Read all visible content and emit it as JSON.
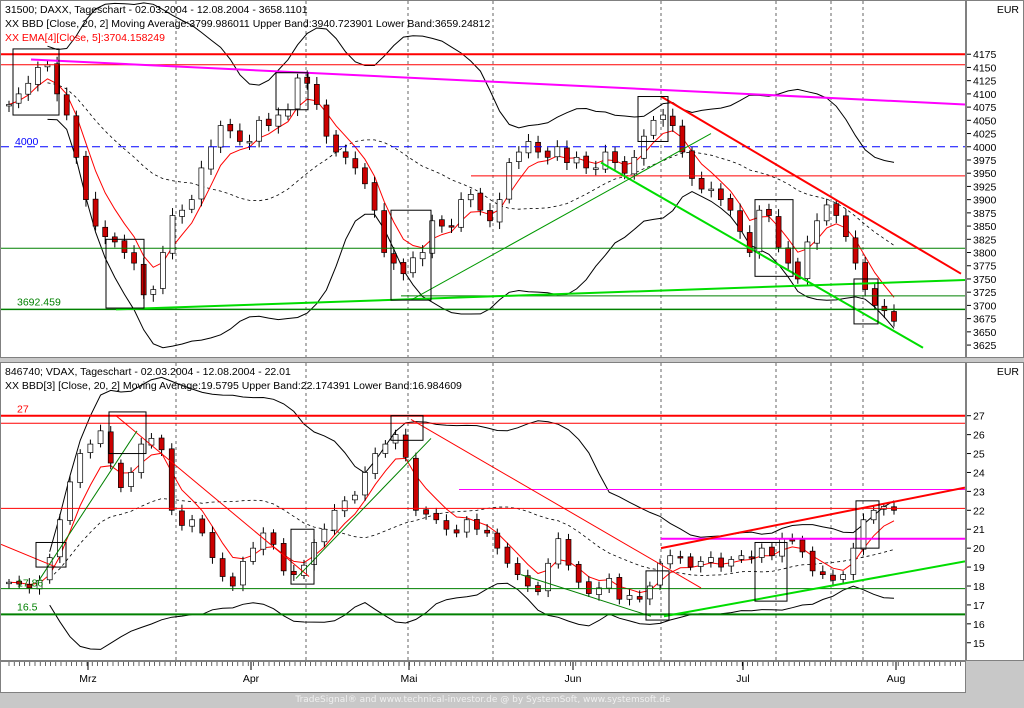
{
  "upper_panel": {
    "header_line1": "31500; DAXX, Tageschart - 02.03.2004 - 12.08.2004 - 3658.1101",
    "header_line2": "XX BBD [Close, 20, 2] Moving Average:3799.986011 Upper Band:3940.723901 Lower Band:3659.24812",
    "header_line3": "XX EMA[4][Close, 5]:3704.158249",
    "currency": "EUR",
    "level_labels": [
      "4000",
      "3692.459"
    ]
  },
  "lower_panel": {
    "header_line1": "846740; VDAX, Tageschart - 02.03.2004 - 12.08.2004 - 22.01",
    "header_line2": "XX BBD[3] [Close, 20, 2] Moving Average:19.5795 Upper Band:22.174391 Lower Band:16.984609",
    "currency": "EUR",
    "level_labels": [
      "27",
      "17.86",
      "16.5"
    ]
  },
  "footer": "TradeSignal® and www.technical-investor.de @ by SystemSoft, www.systemsoft.de",
  "colors": {
    "up": "#ffffff",
    "down": "#cc0000",
    "red": "#ff0000",
    "magenta": "#ff00ff",
    "green": "#00dd00",
    "darkgreen": "#008000",
    "blue": "#0000ff"
  },
  "chart_data": [
    {
      "type": "candlestick",
      "title": "31500; DAXX, Tageschart - 02.03.2004 - 12.08.2004 - 3658.1101",
      "ylim": [
        3610,
        4200
      ],
      "yticks": [
        3625,
        3650,
        3675,
        3700,
        3725,
        3750,
        3775,
        3800,
        3825,
        3850,
        3875,
        3900,
        3925,
        3950,
        3975,
        4000,
        4025,
        4050,
        4075,
        4100,
        4125,
        4150,
        4175
      ],
      "x_months": [
        "Mrz",
        "Apr",
        "Mai",
        "Jun",
        "Jul",
        "Aug"
      ],
      "closes": [
        4080,
        4100,
        4120,
        4150,
        4155,
        4100,
        4060,
        3980,
        3900,
        3850,
        3830,
        3820,
        3800,
        3780,
        3720,
        3730,
        3800,
        3870,
        3880,
        3900,
        3960,
        4000,
        4040,
        4030,
        4010,
        4010,
        4050,
        4040,
        4060,
        4070,
        4130,
        4120,
        4080,
        4020,
        3990,
        3980,
        3960,
        3930,
        3880,
        3800,
        3780,
        3760,
        3790,
        3800,
        3860,
        3850,
        3850,
        3900,
        3910,
        3880,
        3860,
        3900,
        3970,
        3990,
        4010,
        3990,
        3980,
        4000,
        3970,
        3980,
        3960,
        3960,
        3990,
        3970,
        3950,
        3980,
        4020,
        4050,
        4060,
        4040,
        3990,
        3940,
        3920,
        3920,
        3900,
        3880,
        3840,
        3800,
        3880,
        3870,
        3810,
        3780,
        3750,
        3820,
        3860,
        3890,
        3870,
        3830,
        3780,
        3730,
        3700,
        3690,
        3670
      ],
      "overlays": [
        "EMA 5",
        "Bollinger Bands (20, 2)"
      ],
      "levels": [
        3692.459,
        4000
      ]
    },
    {
      "type": "candlestick",
      "title": "846740; VDAX, Tageschart - 02.03.2004 - 12.08.2004 - 22.01",
      "ylim": [
        14.3,
        28.2
      ],
      "yticks": [
        15,
        16,
        17,
        18,
        19,
        20,
        21,
        22,
        23,
        24,
        25,
        26,
        27
      ],
      "x_months": [
        "Mrz",
        "Apr",
        "Mai",
        "Jun",
        "Jul",
        "Aug"
      ],
      "closes": [
        18.2,
        18.1,
        17.9,
        18.3,
        19.5,
        21.5,
        23.5,
        25.0,
        25.5,
        26.2,
        24.5,
        23.2,
        24.0,
        25.5,
        25.8,
        25.2,
        22.0,
        21.2,
        21.5,
        20.8,
        19.5,
        18.5,
        18.0,
        19.3,
        20.0,
        20.8,
        20.2,
        18.8,
        18.6,
        19.1,
        20.3,
        21.0,
        22.0,
        22.5,
        22.8,
        24.0,
        25.0,
        25.5,
        26.0,
        24.8,
        22.0,
        21.8,
        21.5,
        21.0,
        20.8,
        21.5,
        21.0,
        20.8,
        20.0,
        19.2,
        18.6,
        18.0,
        17.7,
        19.2,
        20.5,
        19.1,
        18.2,
        17.6,
        17.9,
        18.4,
        17.3,
        17.5,
        17.3,
        18.0,
        19.2,
        19.6,
        19.5,
        19.0,
        19.3,
        19.5,
        19.0,
        19.4,
        19.6,
        19.5,
        20.0,
        19.6,
        20.5,
        20.4,
        19.8,
        18.8,
        18.6,
        18.3,
        18.6,
        20.0,
        21.5,
        22.0,
        22.2,
        22.0
      ],
      "levels": [
        27,
        17.86,
        16.5
      ]
    }
  ]
}
